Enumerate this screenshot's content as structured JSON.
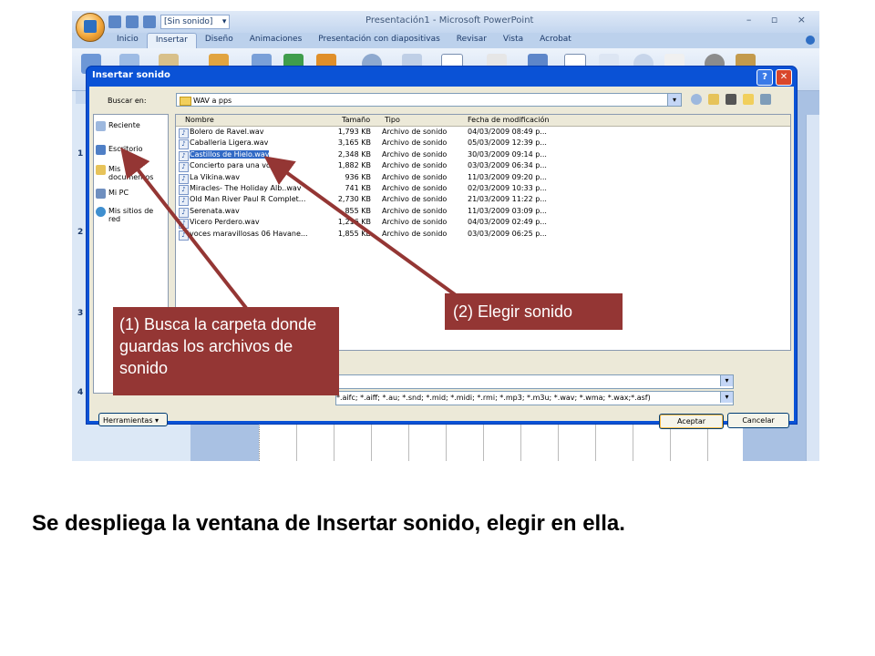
{
  "window": {
    "title": "Presentación1 - Microsoft PowerPoint",
    "controls": "–  ▫  ×",
    "qat_select": "[Sin sonido]"
  },
  "ribbon": {
    "tabs": [
      "Inicio",
      "Insertar",
      "Diseño",
      "Animaciones",
      "Presentación con diapositivas",
      "Revisar",
      "Vista",
      "Acrobat"
    ],
    "active_tab": "Insertar"
  },
  "slide_numbers": [
    "1",
    "2",
    "3",
    "4"
  ],
  "dialog": {
    "title": "Insertar sonido",
    "help_button": "?",
    "close_button": "✕",
    "look_in_label": "Buscar en:",
    "look_in_value": "WAV a pps",
    "places": [
      "Reciente",
      "Escritorio",
      "Mis documentos",
      "Mi PC",
      "Mis sitios de red"
    ],
    "columns": {
      "name": "Nombre",
      "size": "Tamaño",
      "type": "Tipo",
      "date": "Fecha de modificación"
    },
    "files": [
      {
        "name": "Bolero de Ravel.wav",
        "size": "1,793 KB",
        "type": "Archivo de sonido",
        "date": "04/03/2009 08:49 p..."
      },
      {
        "name": "Caballeria Ligera.wav",
        "size": "3,165 KB",
        "type": "Archivo de sonido",
        "date": "05/03/2009 12:39 p..."
      },
      {
        "name": "Castillos de Hielo.wav",
        "size": "2,348 KB",
        "type": "Archivo de sonido",
        "date": "30/03/2009 09:14 p..."
      },
      {
        "name": "Concierto para una voz.wav",
        "size": "1,882 KB",
        "type": "Archivo de sonido",
        "date": "03/03/2009 06:34 p..."
      },
      {
        "name": "La Vikina.wav",
        "size": "936 KB",
        "type": "Archivo de sonido",
        "date": "11/03/2009 09:20 p..."
      },
      {
        "name": "Miracles- The Holiday Alb..wav",
        "size": "741 KB",
        "type": "Archivo de sonido",
        "date": "02/03/2009 10:33 p..."
      },
      {
        "name": "Old Man River Paul R Complet...",
        "size": "2,730 KB",
        "type": "Archivo de sonido",
        "date": "21/03/2009 11:22 p..."
      },
      {
        "name": "Serenata.wav",
        "size": "855 KB",
        "type": "Archivo de sonido",
        "date": "11/03/2009 03:09 p..."
      },
      {
        "name": "Vicero Perdero.wav",
        "size": "1,216 KB",
        "type": "Archivo de sonido",
        "date": "04/03/2009 02:49 p..."
      },
      {
        "name": "voces maravillosas 06 Havane...",
        "size": "1,855 KB",
        "type": "Archivo de sonido",
        "date": "03/03/2009 06:25 p..."
      }
    ],
    "selected_file": "Castillos de Hielo.wav",
    "file_type_value": "*.aifc; *.aiff; *.au; *.snd; *.mid; *.midi; *.rmi; *.mp3; *.m3u; *.wav; *.wma; *.wax;*.asf)",
    "tools_button": "Herramientas",
    "ok_button": "Aceptar",
    "cancel_button": "Cancelar"
  },
  "annotations": {
    "callout1": "(1) Busca la carpeta donde guardas los archivos de sonido",
    "callout2": "(2) Elegir sonido",
    "color": "#943634"
  },
  "caption": "Se despliega la ventana de Insertar sonido, elegir en ella."
}
